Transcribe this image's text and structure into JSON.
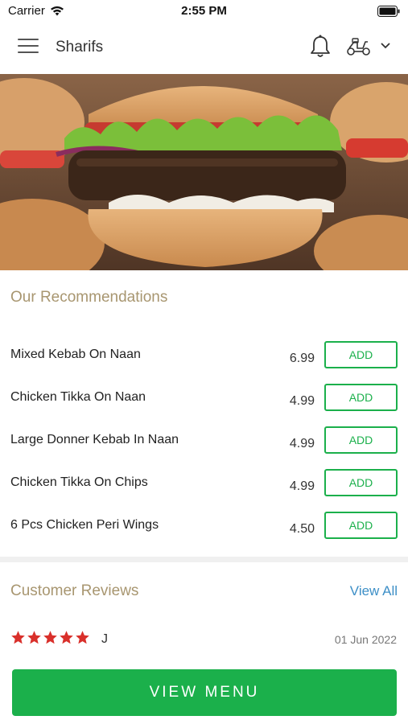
{
  "status_bar": {
    "carrier": "Carrier",
    "time": "2:55 PM"
  },
  "header": {
    "store_name": "Sharifs",
    "icons": [
      "menu-icon",
      "bell-icon",
      "scooter-icon",
      "chevron-down-icon"
    ]
  },
  "recommendations": {
    "title": "Our Recommendations",
    "items": [
      {
        "name": "Mixed Kebab On Naan",
        "price": "6.99",
        "button": "ADD"
      },
      {
        "name": "Chicken Tikka On Naan",
        "price": "4.99",
        "button": "ADD"
      },
      {
        "name": "Large Donner Kebab In Naan",
        "price": "4.99",
        "button": "ADD"
      },
      {
        "name": "Chicken Tikka On Chips",
        "price": "4.99",
        "button": "ADD"
      },
      {
        "name": "6 Pcs Chicken Peri Wings",
        "price": "4.50",
        "button": "ADD"
      }
    ]
  },
  "reviews": {
    "title": "Customer Reviews",
    "view_all": "View All",
    "items": [
      {
        "rating": 5,
        "reviewer": "J",
        "date": "01 Jun 2022"
      }
    ]
  },
  "view_menu_button": "VIEW MENU",
  "colors": {
    "accent_green": "#1bb04b",
    "section_title": "#a89670",
    "link_blue": "#3d8fc7",
    "star_red": "#d9302b"
  }
}
